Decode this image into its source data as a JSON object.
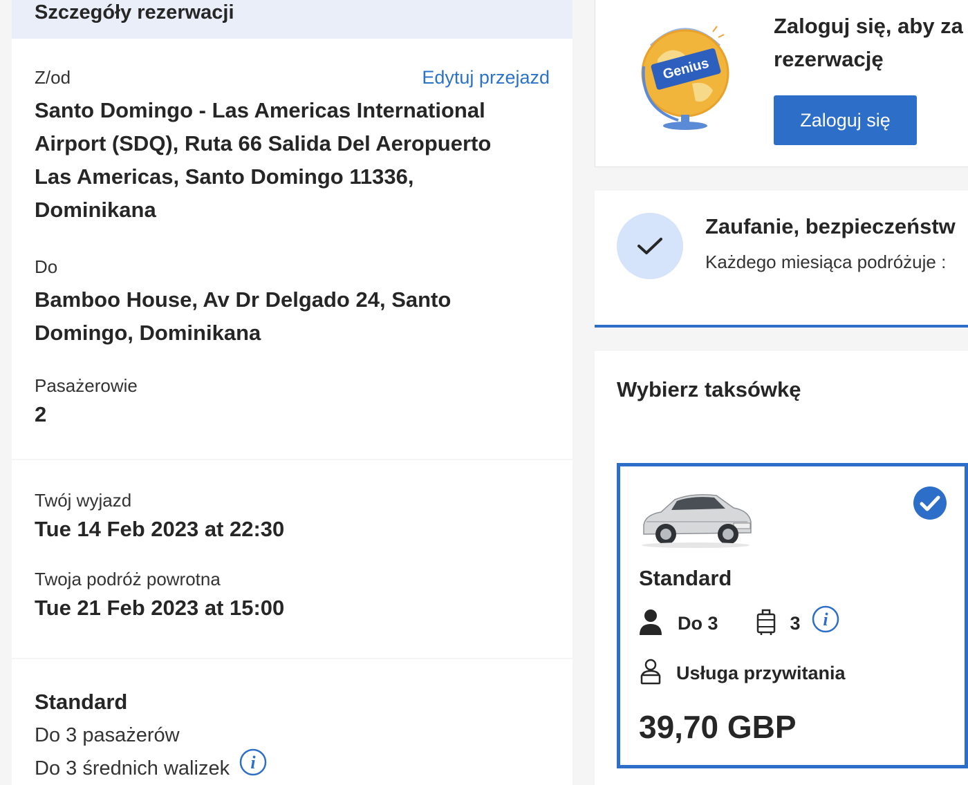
{
  "booking": {
    "header": "Szczegóły rezerwacji",
    "from_label": "Z/od",
    "edit_link": "Edytuj przejazd",
    "from_lines": [
      "Santo Domingo - Las Americas International",
      "Airport (SDQ), Ruta 66 Salida Del Aeropuerto",
      "Las Americas, Santo Domingo 11336,",
      "Dominikana"
    ],
    "to_label": "Do",
    "to_lines": [
      "Bamboo House, Av Dr Delgado 24, Santo",
      "Domingo, Dominikana"
    ],
    "passengers_label": "Pasażerowie",
    "passengers_value": "2",
    "departure_label": "Twój wyjazd",
    "departure_value": "Tue 14 Feb 2023 at 22:30",
    "return_label": "Twoja podróż powrotna",
    "return_value": "Tue 21 Feb 2023 at 15:00",
    "vehicle_name": "Standard",
    "vehicle_passengers": "Do 3 pasażerów",
    "vehicle_bags": "Do 3 średnich walizek"
  },
  "login": {
    "title_line1": "Zaloguj się, aby za",
    "title_line2": "rezerwację",
    "button": "Zaloguj się",
    "badge": "Genius"
  },
  "trust": {
    "title": "Zaufanie, bezpieczeństw",
    "subtitle": "Każdego miesiąca podróżuje :"
  },
  "taxi": {
    "title": "Wybierz taksówkę",
    "option": {
      "name": "Standard",
      "passengers": "Do 3",
      "bags": "3",
      "service": "Usługa przywitania",
      "price": "39,70 GBP"
    }
  },
  "colors": {
    "accent": "#2d6fc8",
    "link": "#2b72c9",
    "header_bg": "#e9eef8",
    "check_bg": "#d5e3fb"
  }
}
